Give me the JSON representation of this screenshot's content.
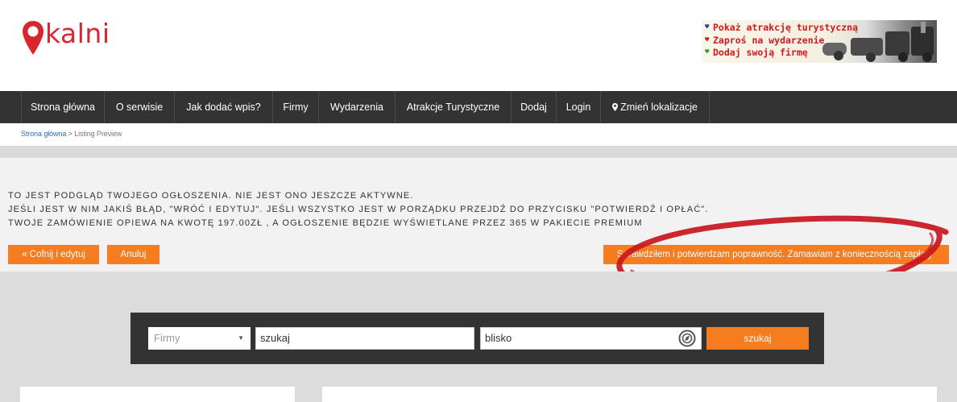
{
  "header": {
    "logo_text": "kalni",
    "logo_icon": "map-pin-icon",
    "brand_color": "#d9262e",
    "banner": {
      "lines": [
        {
          "text": "Pokaż atrakcję turystyczną",
          "icon": "pin-marker-icon",
          "color": "#2e3d9b"
        },
        {
          "text": "Zaproś na wydarzenie",
          "icon": "pin-marker-icon",
          "color": "#cc1b1b"
        },
        {
          "text": "Dodaj swoją firmę",
          "icon": "pin-marker-icon",
          "color": "#2e9b2e"
        }
      ]
    }
  },
  "nav": {
    "items": [
      {
        "label": "Strona główna"
      },
      {
        "label": "O serwisie"
      },
      {
        "label": "Jak dodać wpis?"
      },
      {
        "label": "Firmy"
      },
      {
        "label": "Wydarzenia"
      },
      {
        "label": "Atrakcje Turystyczne"
      },
      {
        "label": "Dodaj"
      },
      {
        "label": "Login"
      },
      {
        "label": "Zmień lokalizacje",
        "icon": "location-marker-icon"
      }
    ]
  },
  "breadcrumb": {
    "home": "Strona główna",
    "separator": " > ",
    "current": "Listing Preview"
  },
  "notice": {
    "lines": [
      "TO JEST PODGLĄD TWOJEGO OGŁOSZENIA. NIE JEST ONO JESZCZE AKTYWNE.",
      "JEŚLI JEST W NIM JAKIŚ BŁĄD, \"WRÓĆ I EDYTUJ\". JEŚLI WSZYSTKO JEST W PORZĄDKU PRZEJDŹ DO PRZYCISKU \"POTWIERDŹ I OPŁAĆ\".",
      "TWOJE ZAMÓWIENIE OPIEWA NA KWOTĘ 197.00ZŁ , A OGŁOSZENIE BĘDZIE WYŚWIETLANE PRZEZ 365 W PAKIECIE PREMIUM"
    ],
    "back_button": "« Cofnij i edytuj",
    "cancel_button": "Anuluj",
    "confirm_button": "Sprawdziłem i potwierdzam poprawność. Zamawiam z koniecznością zapłaty",
    "accent_color": "#f57c1f",
    "annotation_color": "#c8161d"
  },
  "search": {
    "category_selected": "Firmy",
    "query_value": "szukaj",
    "location_value": "blisko",
    "locate_icon": "compass-icon",
    "submit_label": "szukaj"
  }
}
